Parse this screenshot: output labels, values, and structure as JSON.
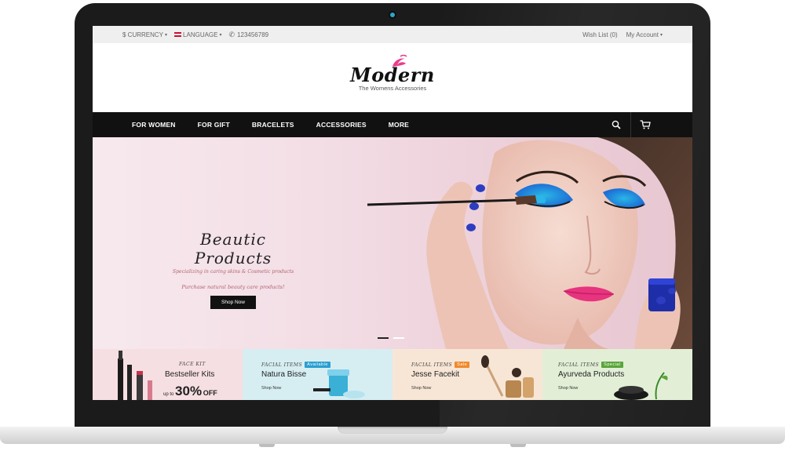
{
  "topbar": {
    "currency": "$ CURRENCY",
    "language": "LANGUAGE",
    "phone": "123456789",
    "wishlist": "Wish List (0)",
    "account": "My Account"
  },
  "logo": {
    "name": "Modern",
    "tagline": "The Womens Accessories"
  },
  "nav": {
    "items": [
      "FOR WOMEN",
      "FOR GIFT",
      "BRACELETS",
      "ACCESSORIES",
      "MORE"
    ]
  },
  "hero": {
    "title": "Beautic Products",
    "subtitle": "Specializing in caring skins & Cosmetic products",
    "line": "Purchase natural beauty care products!",
    "button": "Shop Now"
  },
  "promos": [
    {
      "label": "FACE KIT",
      "title": "Bestseller Kits",
      "badge": "",
      "offer_prefix": "up to",
      "offer_big": "30%",
      "offer_suffix": "OFF",
      "shop": "",
      "bg": "#f6dfe2",
      "badge_color": ""
    },
    {
      "label": "FACIAL ITEMS",
      "title": "Natura Bisse",
      "badge": "Available",
      "shop": "Shop Now",
      "bg": "#d6eef2",
      "badge_color": "#2a9fd0"
    },
    {
      "label": "FACIAL ITEMS",
      "title": "Jesse Facekit",
      "badge": "Sale",
      "shop": "Shop Now",
      "bg": "#f7e6d6",
      "badge_color": "#f08a2c"
    },
    {
      "label": "FACIAL ITEMS",
      "title": "Ayurveda Products",
      "badge": "Special",
      "shop": "Shop Now",
      "bg": "#e2efd6",
      "badge_color": "#5aa53a"
    }
  ],
  "colors": {
    "nav_bg": "#111111",
    "accent_pink": "#e83e8c"
  }
}
